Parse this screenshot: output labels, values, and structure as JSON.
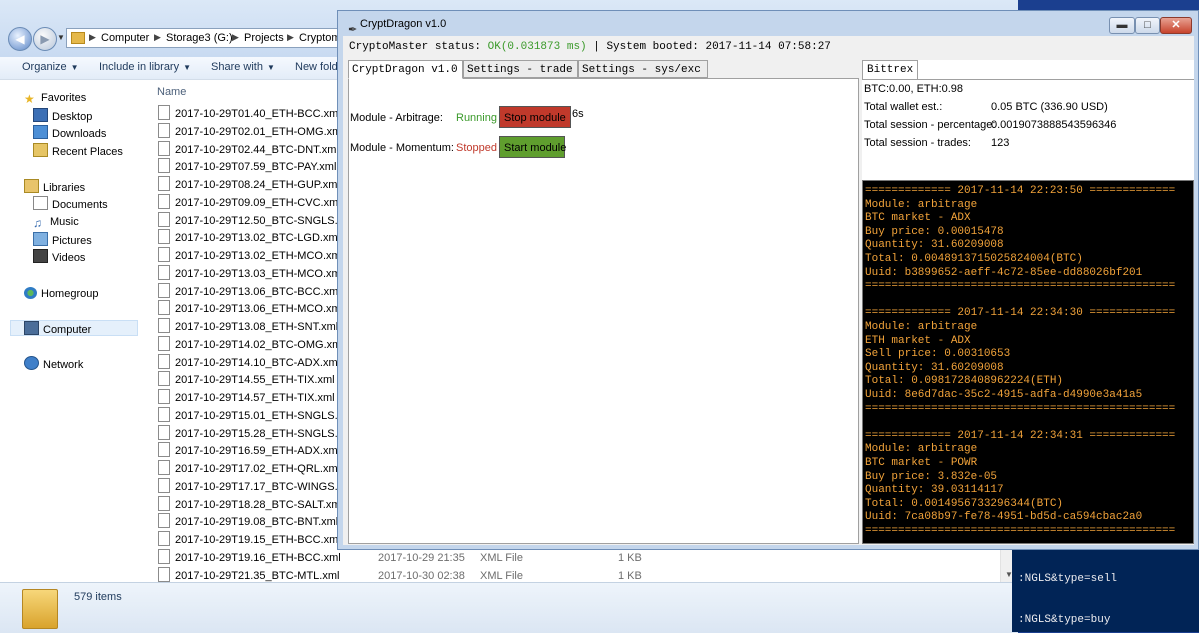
{
  "explorer": {
    "breadcrumb": [
      "Computer",
      "Storage3 (G:)",
      "Projects",
      "Cryptom"
    ],
    "toolbar": {
      "organize": "Organize",
      "include_in_library": "Include in library",
      "share_with": "Share with",
      "new_folder": "New folde"
    },
    "nav_pane": {
      "favorites": "Favorites",
      "desktop": "Desktop",
      "downloads": "Downloads",
      "recent_places": "Recent Places",
      "libraries": "Libraries",
      "documents": "Documents",
      "music": "Music",
      "pictures": "Pictures",
      "videos": "Videos",
      "homegroup": "Homegroup",
      "computer": "Computer",
      "network": "Network"
    },
    "column_name": "Name",
    "files": [
      {
        "name": "2017-10-29T01.40_ETH-BCC.xml"
      },
      {
        "name": "2017-10-29T02.01_ETH-OMG.xml"
      },
      {
        "name": "2017-10-29T02.44_BTC-DNT.xml"
      },
      {
        "name": "2017-10-29T07.59_BTC-PAY.xml"
      },
      {
        "name": "2017-10-29T08.24_ETH-GUP.xml"
      },
      {
        "name": "2017-10-29T09.09_ETH-CVC.xml"
      },
      {
        "name": "2017-10-29T12.50_BTC-SNGLS.xml"
      },
      {
        "name": "2017-10-29T13.02_BTC-LGD.xml"
      },
      {
        "name": "2017-10-29T13.02_ETH-MCO.xml"
      },
      {
        "name": "2017-10-29T13.03_ETH-MCO.xml"
      },
      {
        "name": "2017-10-29T13.06_BTC-BCC.xml"
      },
      {
        "name": "2017-10-29T13.06_ETH-MCO.xml"
      },
      {
        "name": "2017-10-29T13.08_ETH-SNT.xml"
      },
      {
        "name": "2017-10-29T14.02_BTC-OMG.xml"
      },
      {
        "name": "2017-10-29T14.10_BTC-ADX.xml"
      },
      {
        "name": "2017-10-29T14.55_ETH-TIX.xml"
      },
      {
        "name": "2017-10-29T14.57_ETH-TIX.xml"
      },
      {
        "name": "2017-10-29T15.01_ETH-SNGLS.xml"
      },
      {
        "name": "2017-10-29T15.28_ETH-SNGLS.xml"
      },
      {
        "name": "2017-10-29T16.59_ETH-ADX.xml"
      },
      {
        "name": "2017-10-29T17.02_ETH-QRL.xml"
      },
      {
        "name": "2017-10-29T17.17_BTC-WINGS.xml"
      },
      {
        "name": "2017-10-29T18.28_BTC-SALT.xml"
      },
      {
        "name": "2017-10-29T19.08_BTC-BNT.xml"
      },
      {
        "name": "2017-10-29T19.15_ETH-BCC.xml"
      },
      {
        "name": "2017-10-29T19.16_ETH-BCC.xml",
        "date": "2017-10-29 21:35",
        "type": "XML File",
        "size": "1 KB"
      },
      {
        "name": "2017-10-29T21.35_BTC-MTL.xml",
        "date": "2017-10-30 02:38",
        "type": "XML File",
        "size": "1 KB"
      }
    ],
    "status": {
      "count": "579 items"
    }
  },
  "console": {
    "lines": [
      ":NGLS&type=sell",
      ":NGLS&type=buy"
    ]
  },
  "cryptdragon": {
    "title": "CryptDragon v1.0",
    "status_prefix": "CryptoMaster status: ",
    "status_ok": "OK(0.031873 ms)",
    "status_suffix": " | System booted: 2017-11-14 07:58:27",
    "tabs": [
      "CryptDragon v1.0",
      "Settings - trade",
      "Settings - sys/exc"
    ],
    "modules": [
      {
        "label": "Module - Arbitrage:",
        "state": "Running",
        "button": "Stop module",
        "timer": "6s"
      },
      {
        "label": "Module - Momentum:",
        "state": "Stopped",
        "button": "Start module"
      }
    ],
    "bittrex": {
      "tab": "Bittrex",
      "balances": "BTC:0.00, ETH:0.98",
      "rows": [
        {
          "label": "Total wallet est.:",
          "value": "0.05 BTC (336.90 USD)"
        },
        {
          "label": "Total session - percentage:",
          "value": "0.0019073888543596346"
        },
        {
          "label": "Total session - trades:",
          "value": "123"
        }
      ]
    },
    "log": [
      "============= 2017-11-14 22:23:50 =============",
      "Module: arbitrage",
      "BTC market - ADX",
      "Buy price: 0.00015478",
      "Quantity: 31.60209008",
      "Total: 0.0048913715025824004(BTC)",
      "Uuid: b3899652-aeff-4c72-85ee-dd88026bf201",
      "===============================================",
      "",
      "============= 2017-11-14 22:34:30 =============",
      "Module: arbitrage",
      "ETH market - ADX",
      "Sell price: 0.00310653",
      "Quantity: 31.60209008",
      "Total: 0.0981728408962224(ETH)",
      "Uuid: 8e6d7dac-35c2-4915-adfa-d4990e3a41a5",
      "===============================================",
      "",
      "============= 2017-11-14 22:34:31 =============",
      "Module: arbitrage",
      "BTC market - POWR",
      "Buy price: 3.832e-05",
      "Quantity: 39.03114117",
      "Total: 0.0014956733296344(BTC)",
      "Uuid: 7ca08b97-fe78-4951-bd5d-ca594cbac2a0",
      "==============================================="
    ]
  },
  "colors": {
    "running": "#3a9a2a",
    "stopped": "#c0392b",
    "log_text": "#f2a33a",
    "stop_button": "#c0392b",
    "start_button": "#5f9e2e"
  }
}
